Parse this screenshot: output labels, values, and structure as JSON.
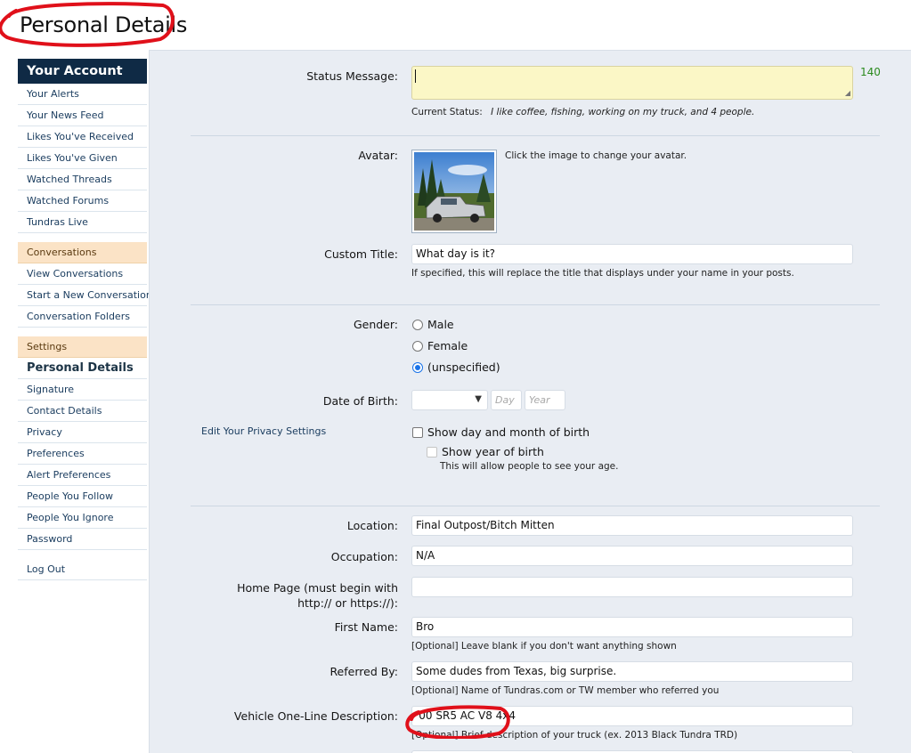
{
  "page": {
    "title": "Personal Details"
  },
  "sidebar": {
    "account_head": "Your Account",
    "account_items": [
      "Your Alerts",
      "Your News Feed",
      "Likes You've Received",
      "Likes You've Given",
      "Watched Threads",
      "Watched Forums",
      "Tundras Live"
    ],
    "conversations_head": "Conversations",
    "conversation_items": [
      "View Conversations",
      "Start a New Conversation",
      "Conversation Folders"
    ],
    "settings_head": "Settings",
    "settings_active": "Personal Details",
    "settings_items": [
      "Signature",
      "Contact Details",
      "Privacy",
      "Preferences",
      "Alert Preferences",
      "People You Follow",
      "People You Ignore",
      "Password"
    ],
    "logout": "Log Out"
  },
  "form": {
    "status_label": "Status Message:",
    "status_value": "",
    "status_counter": "140",
    "current_status_label": "Current Status:",
    "current_status_value": "I like coffee, fishing, working on my truck, and 4 people.",
    "avatar_label": "Avatar:",
    "avatar_hint": "Click the image to change your avatar.",
    "custom_title_label": "Custom Title:",
    "custom_title_value": "What day is it?",
    "custom_title_hint": "If specified, this will replace the title that displays under your name in your posts.",
    "gender_label": "Gender:",
    "gender_options": [
      "Male",
      "Female",
      "(unspecified)"
    ],
    "gender_selected": "(unspecified)",
    "dob_label": "Date of Birth:",
    "dob_day_placeholder": "Day",
    "dob_year_placeholder": "Year",
    "privacy_link": "Edit Your Privacy Settings",
    "show_dob_label": "Show day and month of birth",
    "show_year_label": "Show year of birth",
    "show_year_hint": "This will allow people to see your age.",
    "location_label": "Location:",
    "location_value": "Final Outpost/Bitch Mitten",
    "occupation_label": "Occupation:",
    "occupation_value": "N/A",
    "homepage_label_1": "Home Page (must begin with",
    "homepage_label_2": "http:// or https://):",
    "homepage_value": "",
    "first_name_label": "First Name:",
    "first_name_value": "Bro",
    "first_name_hint": "[Optional] Leave blank if you don't want anything shown",
    "referred_label": "Referred By:",
    "referred_value": "Some dudes from Texas, big surprise.",
    "referred_hint": "[Optional] Name of Tundras.com or TW member who referred you",
    "vehicle_label": "Vehicle One-Line Description:",
    "vehicle_value": "'00 SR5 AC V8 4x4",
    "vehicle_hint": "[Optional] Brief description of your truck (ex. 2013 Black Tundra TRD)"
  }
}
